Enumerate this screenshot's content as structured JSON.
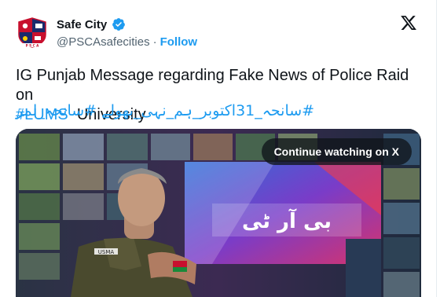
{
  "account": {
    "name": "Safe City",
    "handle": "@PSCAsafecities",
    "separator": "·",
    "follow_label": "Follow"
  },
  "tweet": {
    "text_plain_1": "IG Punjab Message regarding Fake News of Police Raid on",
    "hashtag_lums": "#LUMS",
    "text_plain_2": "University",
    "urdu_hashtags": [
      "#سانحہ_31اکتوبر_ہم_نہی_بھولے",
      "#سانحہ_لمز"
    ]
  },
  "media": {
    "overlay_button": "Continue watching on X",
    "video_caption_snippet": "USMA",
    "screen_graphic_text": "بی آر ٹی"
  },
  "colors": {
    "accent": "#1d9bf0",
    "text": "#0f1419",
    "secondary": "#536471",
    "uniform": "#4a4a2e"
  },
  "icons": {
    "verified": "verified-badge-icon",
    "x_logo": "x-logo-icon",
    "avatar": "safe-city-logo"
  }
}
